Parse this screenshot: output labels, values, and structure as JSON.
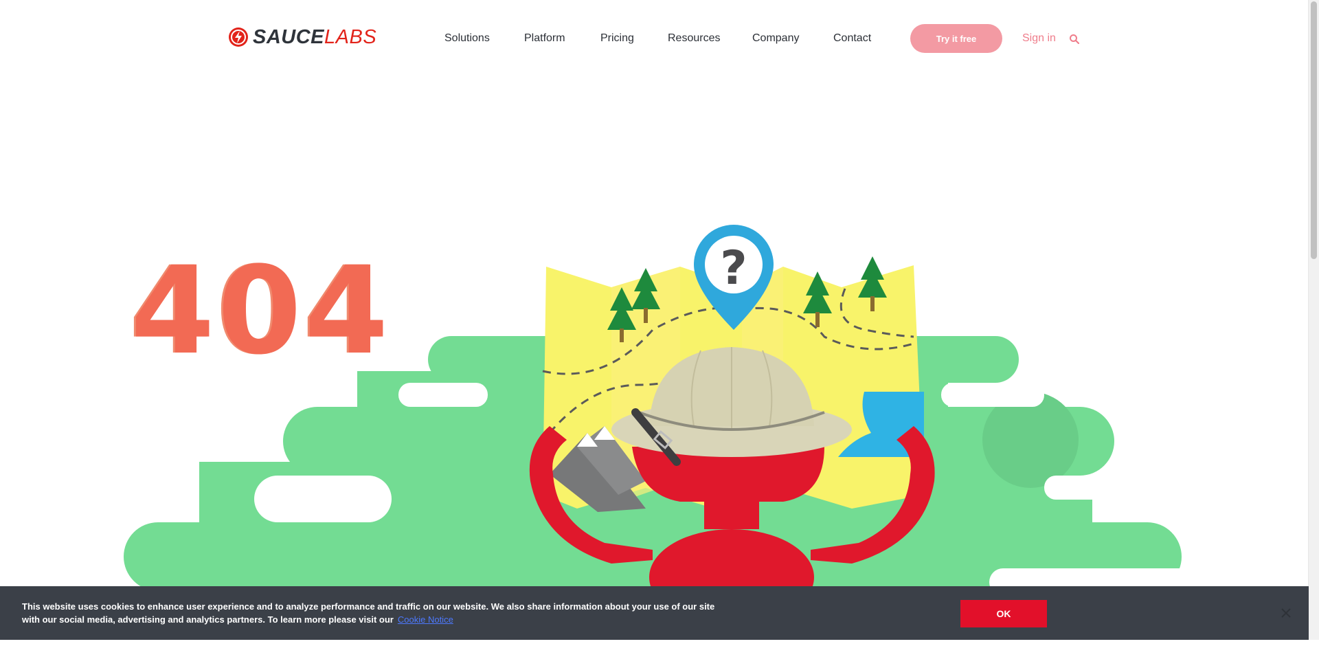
{
  "brand": {
    "name_part1": "SAUCE",
    "name_part2": "LABS",
    "accent": "#e2231a"
  },
  "nav": {
    "items": [
      {
        "label": "Solutions"
      },
      {
        "label": "Platform"
      },
      {
        "label": "Pricing"
      },
      {
        "label": "Resources"
      },
      {
        "label": "Company"
      },
      {
        "label": "Contact"
      }
    ],
    "cta_label": "Try it free",
    "signin_label": "Sign in",
    "search_icon": "search-icon"
  },
  "hero": {
    "code": "404"
  },
  "cookie_banner": {
    "text": "This website uses cookies to enhance user experience and to analyze performance and traffic on our website. We also share information about your use of our site with our social media, advertising and analytics partners. To learn more please visit our",
    "link_label": "Cookie Notice",
    "ok_label": "OK",
    "close_icon": "close-icon"
  },
  "colors": {
    "cta_bg": "#f39aa3",
    "signin": "#ef7d8b",
    "cloud_green": "#73dc93",
    "map_yellow": "#f8f36a",
    "robot_red": "#e0182c",
    "pin_blue": "#2fa8dc",
    "banner_bg": "#3b4048",
    "ok_bg": "#e2102a"
  }
}
